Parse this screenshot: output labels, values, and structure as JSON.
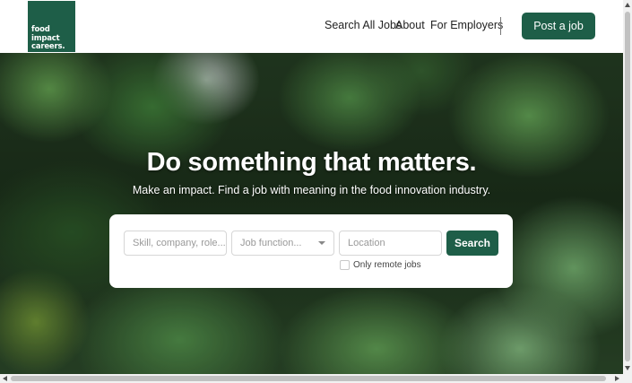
{
  "header": {
    "logo_lines": [
      "food",
      "impact",
      "careers."
    ],
    "nav": {
      "search_all_jobs": "Search All Jobs",
      "about": "About",
      "for_employers": "For Employers"
    },
    "post_job_label": "Post a job"
  },
  "hero": {
    "title": "Do something that matters.",
    "subtitle": "Make an impact. Find a job with meaning in the food innovation industry."
  },
  "search": {
    "skill_placeholder": "Skill, company, role...",
    "job_function_placeholder": "Job function...",
    "location_placeholder": "Location",
    "button_label": "Search",
    "remote_label": "Only remote jobs",
    "remote_checked": false
  },
  "colors": {
    "brand_green": "#1e5e48"
  }
}
